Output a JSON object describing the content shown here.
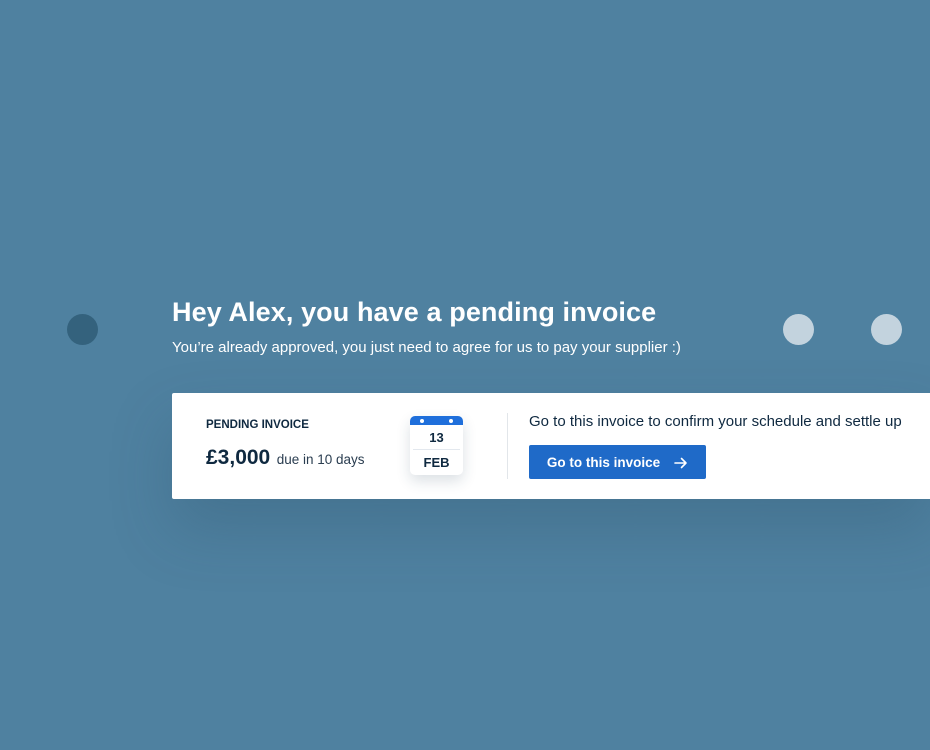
{
  "header": {
    "headline": "Hey Alex, you have a pending invoice",
    "subline": "You’re already approved, you just need to agree for us to pay your supplier :)"
  },
  "invoice": {
    "label": "PENDING INVOICE",
    "amount": "£3,000",
    "due": "due in 10 days",
    "calendar": {
      "day": "13",
      "month": "FEB",
      "icon": "calendar-icon"
    },
    "message": "Go to this invoice to confirm your schedule and settle up",
    "button_label": "Go to this invoice",
    "button_icon": "arrow-right-icon"
  },
  "colors": {
    "background": "#4f81a0",
    "accent": "#1f6ac8",
    "text_dark": "#0f2940"
  }
}
